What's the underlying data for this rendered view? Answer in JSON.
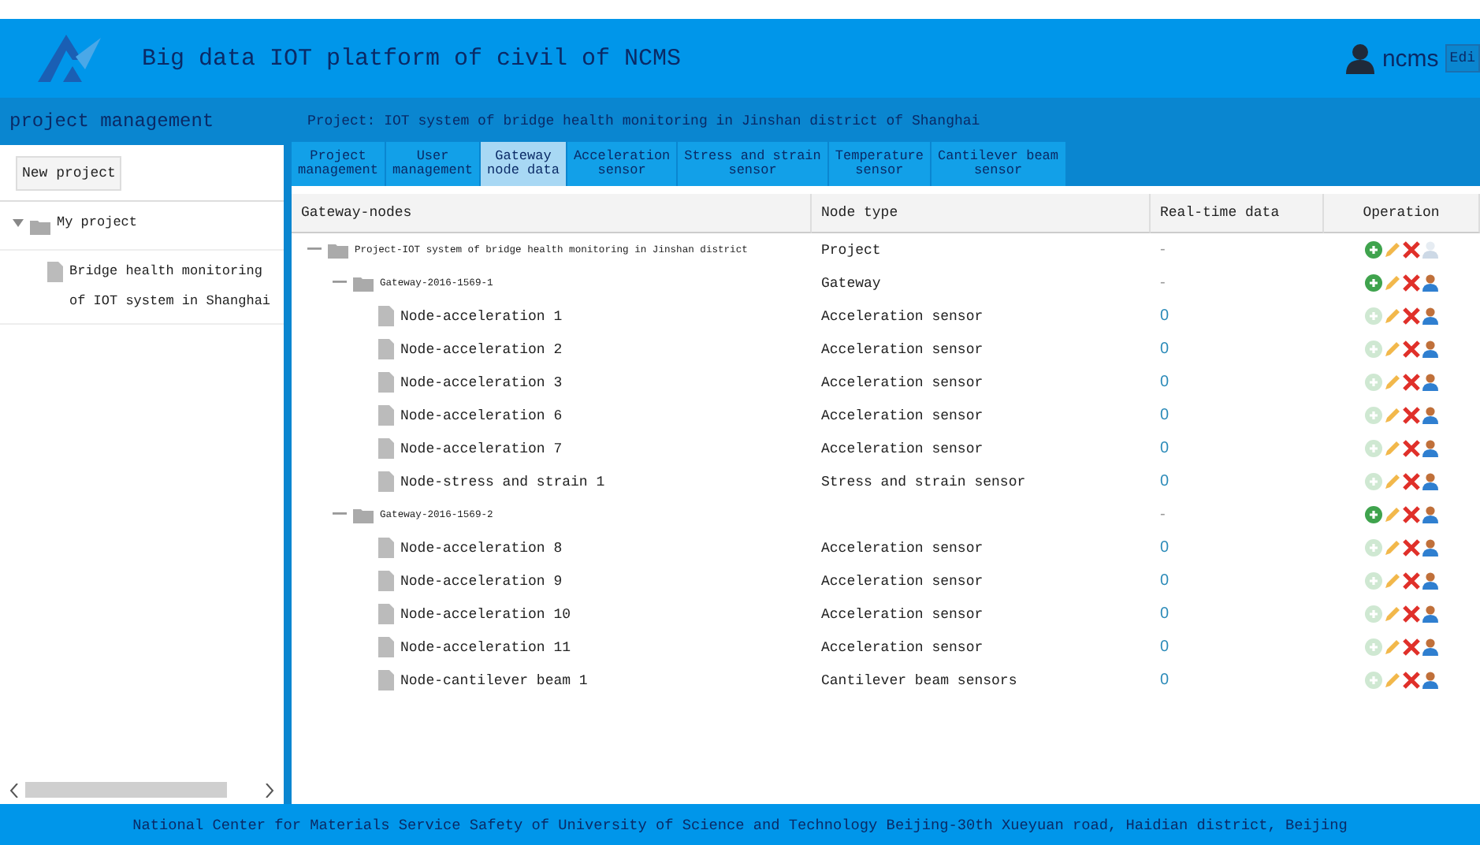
{
  "header": {
    "title": "Big data IOT platform of civil of NCMS",
    "user": "ncms",
    "edit_button": "Edi"
  },
  "sidebar": {
    "title": "project management",
    "new_button": "New project",
    "tree": [
      {
        "label": "My project",
        "expanded": true,
        "children": [
          {
            "label": "Bridge health monitoring of IOT system in Shanghai",
            "selected": false
          }
        ]
      }
    ]
  },
  "main": {
    "project_title": "Project: IOT system of bridge health monitoring in Jinshan district of Shanghai",
    "tabs": [
      {
        "label": "Project\nmanagement",
        "selected": false
      },
      {
        "label": "User\nmanagement",
        "selected": false
      },
      {
        "label": "Gateway\nnode data",
        "selected": true
      },
      {
        "label": "Acceleration\nsensor",
        "selected": false
      },
      {
        "label": "Stress and strain\nsensor",
        "selected": false
      },
      {
        "label": "Temperature\nsensor",
        "selected": false
      },
      {
        "label": "Cantilever beam\nsensor",
        "selected": false
      }
    ],
    "table": {
      "columns": [
        "Gateway-nodes",
        "Node type",
        "Real-time data",
        "Operation"
      ],
      "rows": [
        {
          "kind": "project",
          "name": "Project-IOT system of bridge health monitoring in Jinshan district",
          "type": "Project",
          "realtime": "-",
          "add_enabled": true,
          "user_enabled": false,
          "expanded": true,
          "children": [
            {
              "kind": "gateway",
              "name": "Gateway-2016-1569-1",
              "type": "Gateway",
              "realtime": "-",
              "add_enabled": true,
              "user_enabled": true,
              "expanded": true,
              "children": [
                {
                  "kind": "node",
                  "name": "Node-acceleration 1",
                  "type": "Acceleration sensor",
                  "realtime": "0",
                  "add_enabled": false,
                  "user_enabled": true
                },
                {
                  "kind": "node",
                  "name": "Node-acceleration 2",
                  "type": "Acceleration sensor",
                  "realtime": "0",
                  "add_enabled": false,
                  "user_enabled": true
                },
                {
                  "kind": "node",
                  "name": "Node-acceleration 3",
                  "type": "Acceleration sensor",
                  "realtime": "0",
                  "add_enabled": false,
                  "user_enabled": true
                },
                {
                  "kind": "node",
                  "name": "Node-acceleration 6",
                  "type": "Acceleration sensor",
                  "realtime": "0",
                  "add_enabled": false,
                  "user_enabled": true
                },
                {
                  "kind": "node",
                  "name": "Node-acceleration 7",
                  "type": "Acceleration sensor",
                  "realtime": "0",
                  "add_enabled": false,
                  "user_enabled": true
                },
                {
                  "kind": "node",
                  "name": "Node-stress and strain 1",
                  "type": "Stress and strain sensor",
                  "realtime": "0",
                  "add_enabled": false,
                  "user_enabled": true
                }
              ]
            },
            {
              "kind": "gateway",
              "name": "Gateway-2016-1569-2",
              "realtime": "-",
              "add_enabled": true,
              "user_enabled": true,
              "expanded": true,
              "children": [
                {
                  "kind": "node",
                  "name": "Node-acceleration 8",
                  "type": "Acceleration sensor",
                  "realtime": "0",
                  "add_enabled": false,
                  "user_enabled": true
                },
                {
                  "kind": "node",
                  "name": "Node-acceleration 9",
                  "type": "Acceleration sensor",
                  "realtime": "0",
                  "add_enabled": false,
                  "user_enabled": true
                },
                {
                  "kind": "node",
                  "name": "Node-acceleration 10",
                  "type": "Acceleration sensor",
                  "realtime": "0",
                  "add_enabled": false,
                  "user_enabled": true
                },
                {
                  "kind": "node",
                  "name": "Node-acceleration 11",
                  "type": "Acceleration sensor",
                  "realtime": "0",
                  "add_enabled": false,
                  "user_enabled": true
                },
                {
                  "kind": "node",
                  "name": "Node-cantilever beam 1",
                  "type": "Cantilever beam sensors",
                  "realtime": "0",
                  "add_enabled": false,
                  "user_enabled": true
                }
              ]
            }
          ]
        }
      ]
    }
  },
  "footer": "National Center for Materials Service Safety of University of Science and Technology Beijing-30th Xueyuan road, Haidian district, Beijing"
}
